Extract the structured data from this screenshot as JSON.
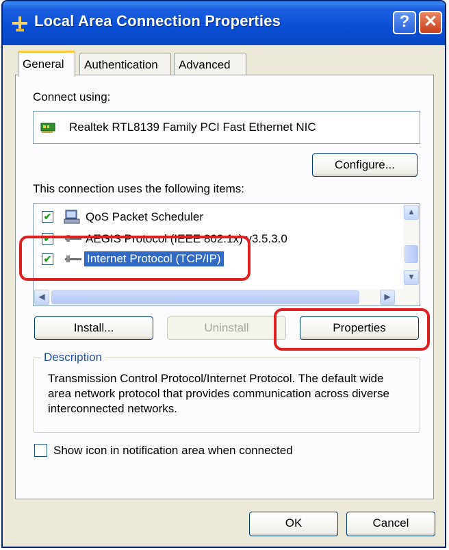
{
  "window": {
    "title": "Local Area Connection Properties",
    "help_label": "?",
    "close_label": "✕"
  },
  "tabs": [
    {
      "label": "General",
      "active": true
    },
    {
      "label": "Authentication",
      "active": false
    },
    {
      "label": "Advanced",
      "active": false
    }
  ],
  "general": {
    "connect_using_label": "Connect using:",
    "adapter_name": "Realtek RTL8139 Family PCI Fast Ethernet NIC",
    "configure_label": "Configure...",
    "items_label": "This connection uses the following items:",
    "items": [
      {
        "label": "QoS Packet Scheduler",
        "checked": true,
        "icon": "scheduler-icon"
      },
      {
        "label": "AEGIS Protocol (IEEE 802.1x) v3.5.3.0",
        "checked": true,
        "icon": "protocol-icon"
      },
      {
        "label": "Internet Protocol (TCP/IP)",
        "checked": true,
        "selected": true,
        "icon": "protocol-icon"
      }
    ],
    "install_label": "Install...",
    "uninstall_label": "Uninstall",
    "properties_label": "Properties",
    "description_title": "Description",
    "description_text": "Transmission Control Protocol/Internet Protocol. The default wide area network protocol that provides communication across diverse interconnected networks.",
    "show_icon_label": "Show icon in notification area when connected",
    "show_icon_checked": false
  },
  "footer": {
    "ok_label": "OK",
    "cancel_label": "Cancel"
  },
  "colors": {
    "title_bar": "#0a4fd6",
    "selection": "#316ac5",
    "highlight_annotation": "#e02020",
    "dialog_face": "#ece9d8"
  }
}
